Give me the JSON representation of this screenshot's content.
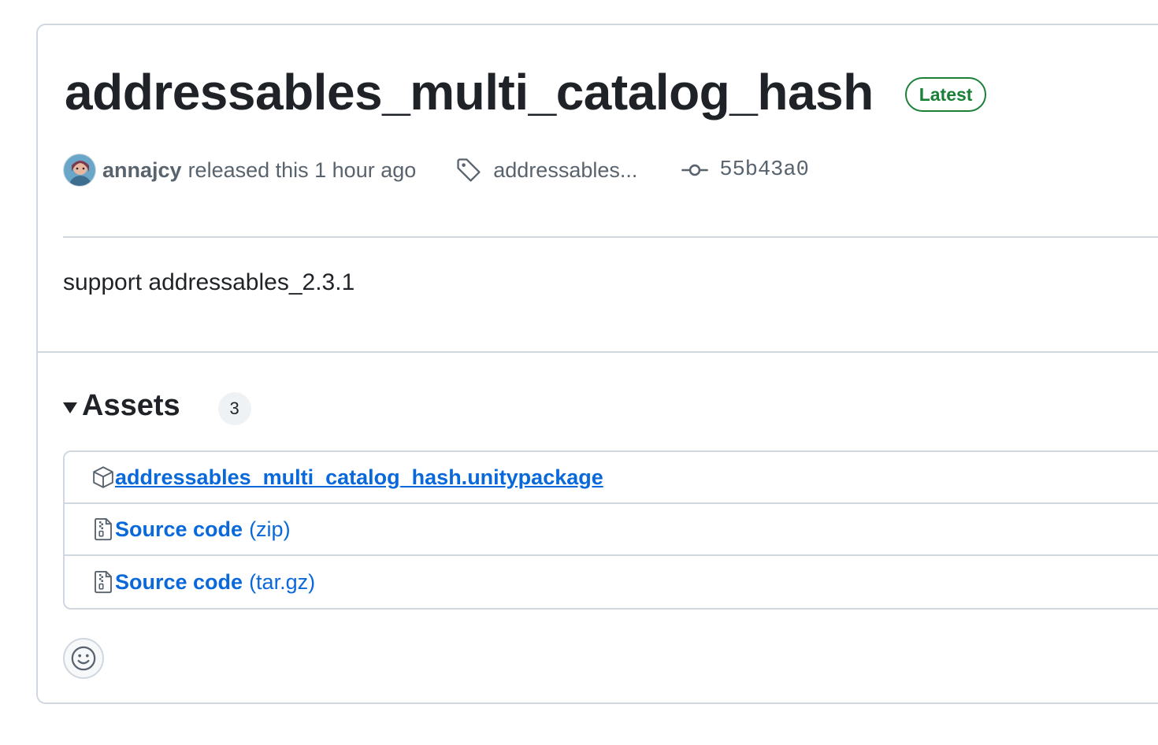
{
  "release": {
    "title": "addressables_multi_catalog_hash",
    "badge": "Latest",
    "author": "annajcy",
    "released_text": "released this 1 hour ago",
    "tag": "addressables...",
    "commit": "55b43a0",
    "body": "support addressables_2.3.1"
  },
  "assets": {
    "heading": "Assets",
    "count": "3",
    "items": [
      {
        "icon": "package-icon",
        "label": "addressables_multi_catalog_hash.unitypackage",
        "suffix": ""
      },
      {
        "icon": "file-zip-icon",
        "label": "Source code",
        "suffix": "(zip)"
      },
      {
        "icon": "file-zip-icon",
        "label": "Source code",
        "suffix": "(tar.gz)"
      }
    ]
  },
  "reactions": {
    "icon": "smiley-icon"
  },
  "colors": {
    "link": "#0969da",
    "latest": "#1a7f37",
    "muted": "#59636e",
    "border": "#d0d7de",
    "text": "#1f2328"
  }
}
